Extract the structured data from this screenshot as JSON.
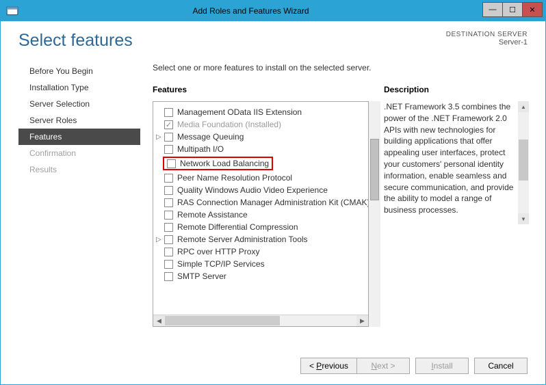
{
  "window": {
    "title": "Add Roles and Features Wizard"
  },
  "header": {
    "page_title": "Select features",
    "destination_label": "DESTINATION SERVER",
    "destination_value": "Server-1"
  },
  "nav": {
    "items": [
      {
        "label": "Before You Begin",
        "state": "normal"
      },
      {
        "label": "Installation Type",
        "state": "normal"
      },
      {
        "label": "Server Selection",
        "state": "normal"
      },
      {
        "label": "Server Roles",
        "state": "normal"
      },
      {
        "label": "Features",
        "state": "active"
      },
      {
        "label": "Confirmation",
        "state": "disabled"
      },
      {
        "label": "Results",
        "state": "disabled"
      }
    ]
  },
  "body": {
    "instruction": "Select one or more features to install on the selected server.",
    "features_header": "Features",
    "description_header": "Description",
    "description_text": ".NET Framework 3.5 combines the power of the .NET Framework 2.0 APIs with new technologies for building applications that offer appealing user interfaces, protect your customers' personal identity information, enable seamless and secure communication, and provide the ability to model a range of business processes."
  },
  "features": [
    {
      "label": "Management OData IIS Extension",
      "checked": false,
      "expander": "",
      "installed": false,
      "highlighted": false
    },
    {
      "label": "Media Foundation (Installed)",
      "checked": true,
      "expander": "",
      "installed": true,
      "highlighted": false
    },
    {
      "label": "Message Queuing",
      "checked": false,
      "expander": "▷",
      "installed": false,
      "highlighted": false
    },
    {
      "label": "Multipath I/O",
      "checked": false,
      "expander": "",
      "installed": false,
      "highlighted": false
    },
    {
      "label": "Network Load Balancing",
      "checked": false,
      "expander": "",
      "installed": false,
      "highlighted": true
    },
    {
      "label": "Peer Name Resolution Protocol",
      "checked": false,
      "expander": "",
      "installed": false,
      "highlighted": false
    },
    {
      "label": "Quality Windows Audio Video Experience",
      "checked": false,
      "expander": "",
      "installed": false,
      "highlighted": false
    },
    {
      "label": "RAS Connection Manager Administration Kit (CMAK)",
      "checked": false,
      "expander": "",
      "installed": false,
      "highlighted": false
    },
    {
      "label": "Remote Assistance",
      "checked": false,
      "expander": "",
      "installed": false,
      "highlighted": false
    },
    {
      "label": "Remote Differential Compression",
      "checked": false,
      "expander": "",
      "installed": false,
      "highlighted": false
    },
    {
      "label": "Remote Server Administration Tools",
      "checked": false,
      "expander": "▷",
      "installed": false,
      "highlighted": false
    },
    {
      "label": "RPC over HTTP Proxy",
      "checked": false,
      "expander": "",
      "installed": false,
      "highlighted": false
    },
    {
      "label": "Simple TCP/IP Services",
      "checked": false,
      "expander": "",
      "installed": false,
      "highlighted": false
    },
    {
      "label": "SMTP Server",
      "checked": false,
      "expander": "",
      "installed": false,
      "highlighted": false
    }
  ],
  "buttons": {
    "previous": "< Previous",
    "next": "Next >",
    "install": "Install",
    "cancel": "Cancel"
  }
}
